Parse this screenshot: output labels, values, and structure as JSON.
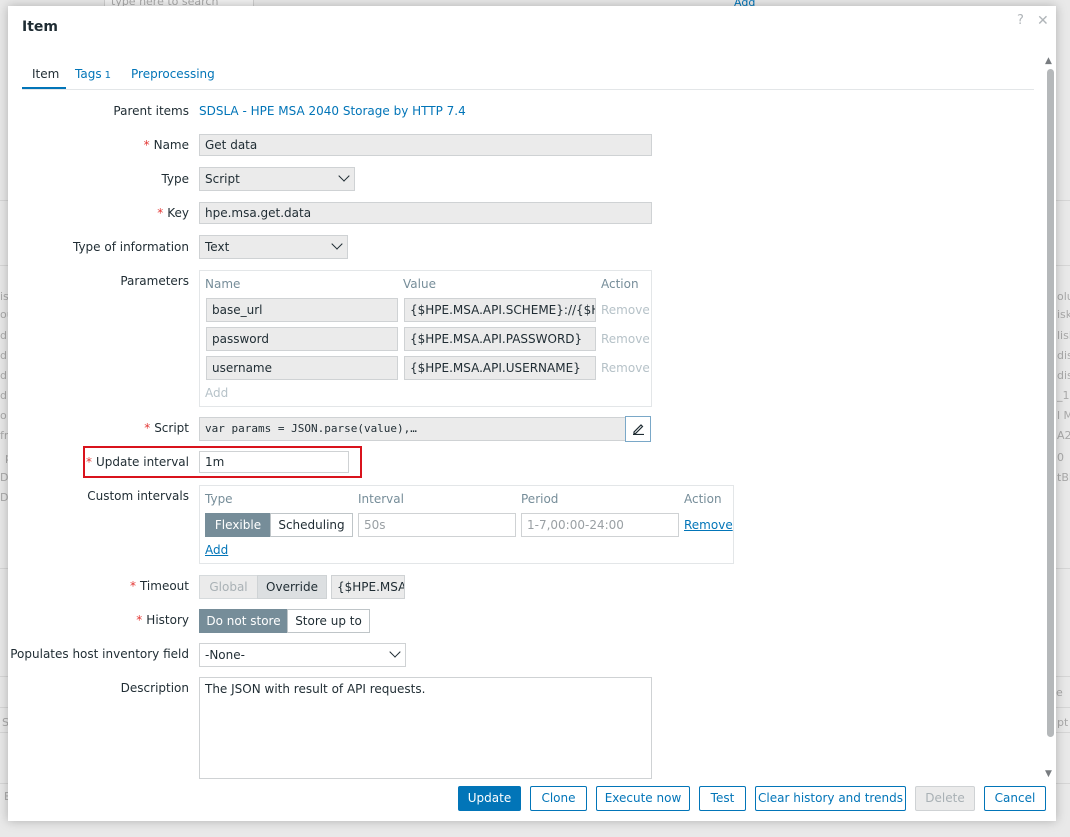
{
  "background": {
    "search_placeholder": "type here to search",
    "add_link": "Add",
    "left_fragments": [
      "isk",
      "oup",
      "dis",
      "dis",
      "dis",
      "dis",
      "o",
      "fru",
      "p",
      "DS",
      "DS"
    ],
    "right_fragments": [
      "olu",
      "isk",
      "lisk",
      "disk",
      "disk",
      "_1",
      "l M",
      "A2",
      "0",
      "tBl"
    ],
    "bottom_left": [
      "S",
      "E"
    ],
    "bottom_right": [
      "e",
      "pt"
    ]
  },
  "dialog": {
    "title": "Item",
    "help_icon": "?",
    "close_icon": "✕"
  },
  "tabs": [
    {
      "label": "Item",
      "count": ""
    },
    {
      "label": "Tags",
      "count": "1"
    },
    {
      "label": "Preprocessing",
      "count": ""
    }
  ],
  "form": {
    "parent_items": {
      "label": "Parent items",
      "value": "SDSLA - HPE MSA 2040 Storage by HTTP 7.4"
    },
    "name": {
      "label": "Name",
      "value": "Get data"
    },
    "type": {
      "label": "Type",
      "value": "Script"
    },
    "key": {
      "label": "Key",
      "value": "hpe.msa.get.data"
    },
    "type_of_information": {
      "label": "Type of information",
      "value": "Text"
    },
    "parameters": {
      "label": "Parameters",
      "headers": {
        "name": "Name",
        "value": "Value",
        "action": "Action"
      },
      "rows": [
        {
          "name": "base_url",
          "value": "{$HPE.MSA.API.SCHEME}://{$HPE",
          "action": "Remove"
        },
        {
          "name": "password",
          "value": "{$HPE.MSA.API.PASSWORD}",
          "action": "Remove"
        },
        {
          "name": "username",
          "value": "{$HPE.MSA.API.USERNAME}",
          "action": "Remove"
        }
      ],
      "add": "Add"
    },
    "script": {
      "label": "Script",
      "value": "var params = JSON.parse(value),…"
    },
    "update_interval": {
      "label": "Update interval",
      "value": "1m"
    },
    "custom_intervals": {
      "label": "Custom intervals",
      "headers": {
        "type": "Type",
        "interval": "Interval",
        "period": "Period",
        "action": "Action"
      },
      "flexible": "Flexible",
      "scheduling": "Scheduling",
      "interval_placeholder": "50s",
      "period_placeholder": "1-7,00:00-24:00",
      "remove": "Remove",
      "add": "Add"
    },
    "timeout": {
      "label": "Timeout",
      "global": "Global",
      "override": "Override",
      "value": "{$HPE.MSA"
    },
    "history": {
      "label": "History",
      "do_not_store": "Do not store",
      "store_up_to": "Store up to"
    },
    "inventory": {
      "label": "Populates host inventory field",
      "value": "-None-"
    },
    "description": {
      "label": "Description",
      "value": "The JSON with result of API requests."
    }
  },
  "footer": {
    "update": "Update",
    "clone": "Clone",
    "execute_now": "Execute now",
    "test": "Test",
    "clear_history": "Clear history and trends",
    "delete": "Delete",
    "cancel": "Cancel"
  },
  "colors": {
    "accent": "#0275b8",
    "required": "#e33734",
    "highlight_box": "#d9131c",
    "segment_active": "#768d99"
  }
}
